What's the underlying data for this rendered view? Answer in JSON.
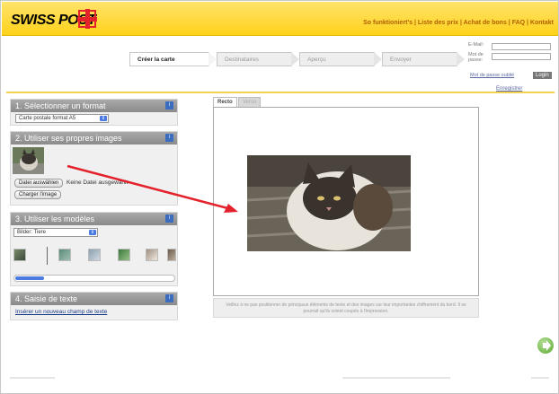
{
  "header": {
    "logo_text": "SWISS POST",
    "toplinks": "So funktioniert's | Liste des prix | Achat de bons | FAQ | Kontakt"
  },
  "steps": [
    {
      "label": "Créer la carte",
      "active": true
    },
    {
      "label": "Destinataires",
      "active": false
    },
    {
      "label": "Aperçu",
      "active": false
    },
    {
      "label": "Envoyer",
      "active": false
    }
  ],
  "login": {
    "email_label": "E-Mail:",
    "password_label": "Mot de passe:",
    "forgot": "Mot de passe oublié",
    "login_button": "Login",
    "register": "Enregistrer"
  },
  "panels": {
    "format": {
      "title": "1. Sélectionner un format",
      "select_value": "Carte postale format A5"
    },
    "images": {
      "title": "2. Utiliser ses propres images",
      "choose_file": "Datei auswählen",
      "no_file": "Keine Datei ausgewählt",
      "upload": "Charger l'image"
    },
    "models": {
      "title": "3. Utiliser les modèles",
      "select_value": "Bilder: Tiere"
    },
    "text": {
      "title": "4. Saisie de texte",
      "insert_link": "Insérer un nouveau champ de texte"
    }
  },
  "canvas": {
    "tab_front": "Recto",
    "tab_back": "Verso",
    "hint": "Veillez à ne pas positionner de principaux éléments de texte et des images sur leur importantes chiffrement du bord. Il se pourrait qu'ils soient coupés à l'impression."
  },
  "colors": {
    "header_yellow": "#ffd21a",
    "post_red": "#e3222b",
    "arrow_red": "#e3222b",
    "info_blue": "#3a6cc0",
    "next_green": "#5aa830"
  },
  "icons": {
    "logo_cross": "swiss-post-cross-icon",
    "info": "info-icon",
    "select_arrow": "chevron-updown-icon",
    "next": "arrow-right-icon"
  }
}
